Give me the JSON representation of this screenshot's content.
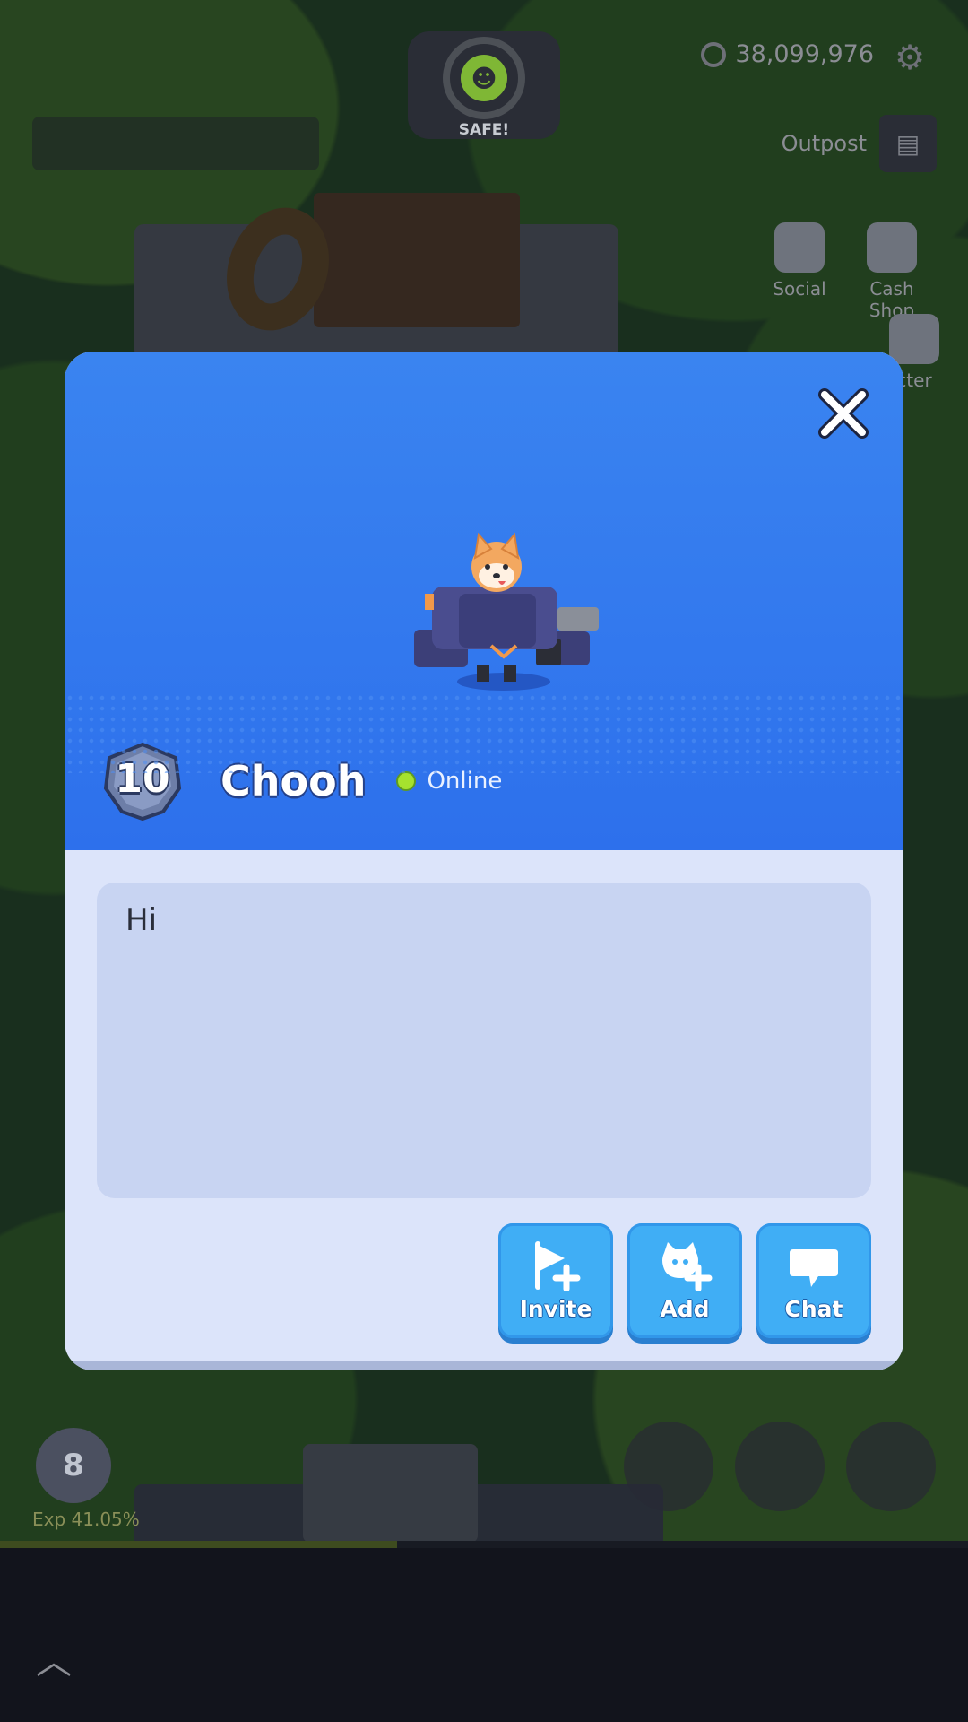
{
  "hud": {
    "safe_label": "SAFE!",
    "currency_value": "38,099,976",
    "outpost_label": "Outpost",
    "side_buttons": [
      {
        "label": "Social"
      },
      {
        "label": "Cash Shop"
      },
      {
        "label": "cter"
      }
    ],
    "player_level": "8",
    "exp_label": "Exp 41.05%",
    "exp_progress": 0.41
  },
  "profile": {
    "level": "10",
    "name": "Chooh",
    "status": "Online",
    "message": "Hi",
    "buttons": {
      "invite": "Invite",
      "add": "Add",
      "chat": "Chat"
    }
  },
  "colors": {
    "hero_blue": "#2d70ec",
    "button_blue": "#40aef5",
    "online_green": "#a6e22e",
    "panel_bg": "#dce4fa"
  },
  "icons": {
    "close": "close-icon",
    "invite": "flag-plus-icon",
    "add": "add-friend-icon",
    "chat": "speech-bubble-icon",
    "settings": "gear-icon",
    "currency": "coin-icon"
  }
}
